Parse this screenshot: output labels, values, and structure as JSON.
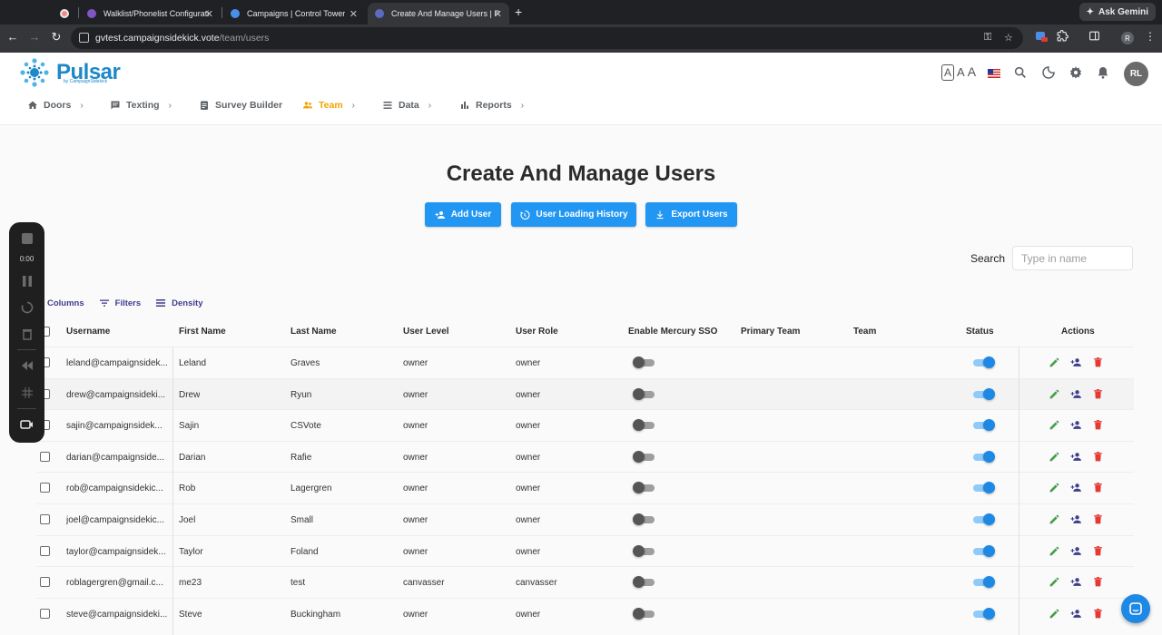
{
  "browser": {
    "tabs": [
      {
        "title": ""
      },
      {
        "title": "Walklist/Phonelist Configurati"
      },
      {
        "title": "Campaigns | Control Tower"
      },
      {
        "title": "Create And Manage Users | P"
      }
    ],
    "gemini_label": "Ask Gemini",
    "url_host": "gvtest.campaignsidekick.vote",
    "url_path": "/team/users",
    "profile_initial": "R"
  },
  "app": {
    "logo_text": "Pulsar",
    "logo_sub": "by CampaignSidekick",
    "text_size_labels": [
      "A",
      "A",
      "A"
    ],
    "avatar_initials": "RL",
    "nav": [
      {
        "label": "Doors",
        "icon": "home-icon"
      },
      {
        "label": "Texting",
        "icon": "message-icon"
      },
      {
        "label": "Survey Builder",
        "icon": "clipboard-icon"
      },
      {
        "label": "Team",
        "icon": "people-icon"
      },
      {
        "label": "Data",
        "icon": "list-icon"
      },
      {
        "label": "Reports",
        "icon": "bar-chart-icon"
      }
    ],
    "active_color": "#f0a500"
  },
  "page": {
    "title": "Create And Manage Users",
    "buttons": {
      "add_user": "Add User",
      "loading_history": "User Loading History",
      "export_users": "Export Users"
    },
    "search": {
      "label": "Search",
      "placeholder": "Type in name"
    },
    "toolbar": {
      "columns": "Columns",
      "filters": "Filters",
      "density": "Density"
    },
    "accent_color": "#2196f3"
  },
  "table": {
    "headers": {
      "username": "Username",
      "first_name": "First Name",
      "last_name": "Last Name",
      "user_level": "User Level",
      "user_role": "User Role",
      "mercury_sso": "Enable Mercury SSO",
      "primary_team": "Primary Team",
      "team": "Team",
      "status": "Status",
      "actions": "Actions"
    },
    "rows": [
      {
        "username": "leland@campaignsidek...",
        "first": "Leland",
        "last": "Graves",
        "level": "owner",
        "role": "owner",
        "sso": false,
        "status": true
      },
      {
        "username": "drew@campaignsideki...",
        "first": "Drew",
        "last": "Ryun",
        "level": "owner",
        "role": "owner",
        "sso": false,
        "status": true
      },
      {
        "username": "sajin@campaignsidek...",
        "first": "Sajin",
        "last": "CSVote",
        "level": "owner",
        "role": "owner",
        "sso": false,
        "status": true
      },
      {
        "username": "darian@campaignside...",
        "first": "Darian",
        "last": "Rafie",
        "level": "owner",
        "role": "owner",
        "sso": false,
        "status": true
      },
      {
        "username": "rob@campaignsidekic...",
        "first": "Rob",
        "last": "Lagergren",
        "level": "owner",
        "role": "owner",
        "sso": false,
        "status": true
      },
      {
        "username": "joel@campaignsidekic...",
        "first": "Joel",
        "last": "Small",
        "level": "owner",
        "role": "owner",
        "sso": false,
        "status": true
      },
      {
        "username": "taylor@campaignsidek...",
        "first": "Taylor",
        "last": "Foland",
        "level": "owner",
        "role": "owner",
        "sso": false,
        "status": true
      },
      {
        "username": "roblagergren@gmail.c...",
        "first": "me23",
        "last": "test",
        "level": "canvasser",
        "role": "canvasser",
        "sso": false,
        "status": true
      },
      {
        "username": "steve@campaignsideki...",
        "first": "Steve",
        "last": "Buckingham",
        "level": "owner",
        "role": "owner",
        "sso": false,
        "status": true
      }
    ]
  },
  "recorder": {
    "time": "0:00"
  }
}
